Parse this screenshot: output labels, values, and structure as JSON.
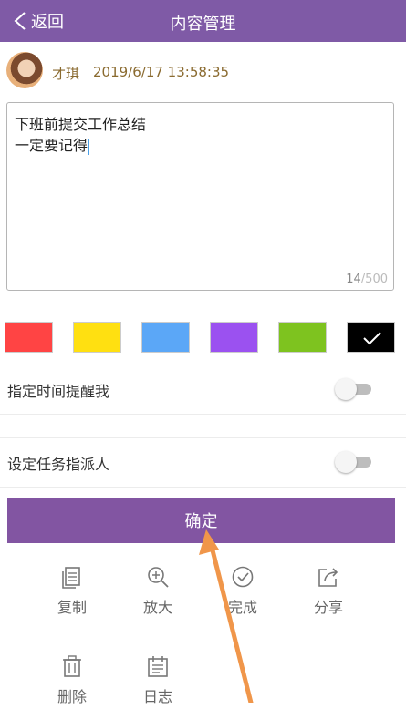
{
  "header": {
    "back_label": "返回",
    "title": "内容管理"
  },
  "note": {
    "author": "才琪",
    "timestamp": "2019/6/17 13:58:35",
    "lines": [
      "下班前提交工作总结",
      "一定要记得"
    ],
    "char_count": "14",
    "char_max": "/500"
  },
  "colors": [
    {
      "name": "red",
      "hex": "#ff4444",
      "selected": false
    },
    {
      "name": "yellow",
      "hex": "#ffe011",
      "selected": false
    },
    {
      "name": "blue",
      "hex": "#5ba7f7",
      "selected": false
    },
    {
      "name": "purple",
      "hex": "#9b51f0",
      "selected": false
    },
    {
      "name": "green",
      "hex": "#7ec31f",
      "selected": false
    },
    {
      "name": "black",
      "hex": "#000000",
      "selected": true
    }
  ],
  "settings": {
    "reminder_label": "指定时间提醒我",
    "reminder_on": false,
    "assign_label": "设定任务指派人",
    "assign_on": false
  },
  "confirm_label": "确定",
  "actions": [
    {
      "id": "copy",
      "label": "复制",
      "icon": "copy-icon"
    },
    {
      "id": "zoom",
      "label": "放大",
      "icon": "zoom-in-icon"
    },
    {
      "id": "done",
      "label": "完成",
      "icon": "check-circle-icon"
    },
    {
      "id": "share",
      "label": "分享",
      "icon": "share-icon"
    },
    {
      "id": "delete",
      "label": "删除",
      "icon": "trash-icon"
    },
    {
      "id": "log",
      "label": "日志",
      "icon": "log-icon"
    }
  ],
  "theme": {
    "accent": "#8255a2",
    "header": "#7f5aa6",
    "annotation_arrow": "#f0964a"
  }
}
